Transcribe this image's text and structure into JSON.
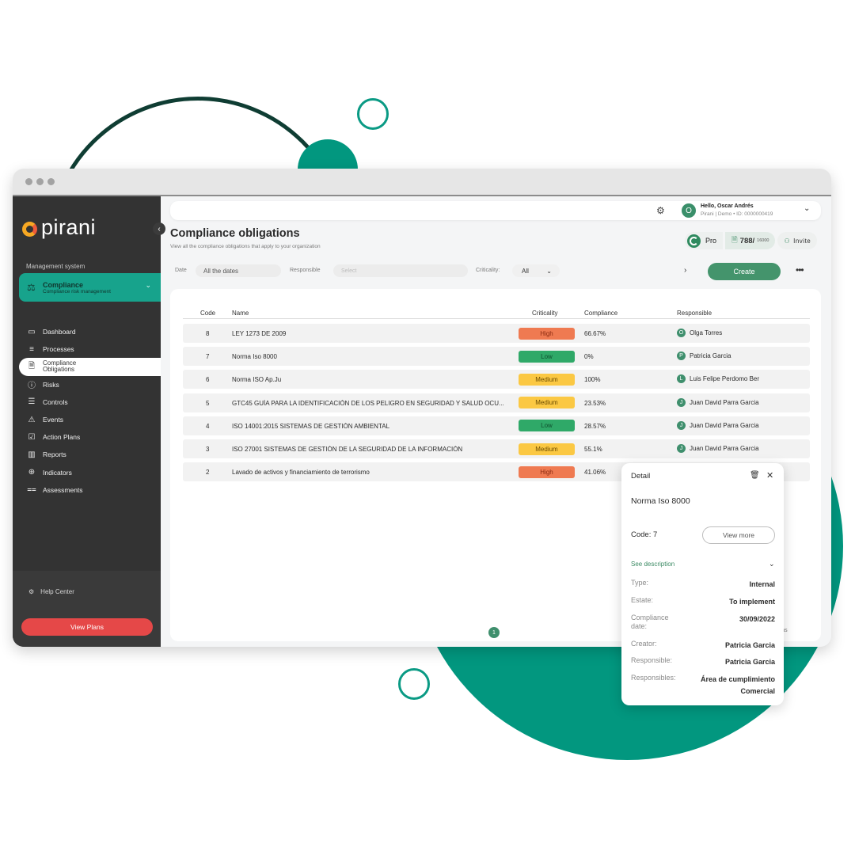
{
  "app": {
    "brand": "pirani",
    "colors": {
      "accent": "#17a38c",
      "primary_button": "#44946c",
      "danger_button": "#e54848",
      "high": "#ef7a51",
      "low": "#2fa968",
      "medium": "#fbc843",
      "sidebar": "#333333"
    }
  },
  "sidebar": {
    "section_label": "Management system",
    "module": {
      "title": "Compliance",
      "subtitle": "Compliance risk management",
      "icon": "compliance-icon"
    },
    "items": [
      {
        "label": "Dashboard",
        "icon": "monitor-icon",
        "active": false
      },
      {
        "label": "Processes",
        "icon": "list-icon",
        "active": false
      },
      {
        "label": "Compliance Obligations",
        "icon": "document-icon",
        "active": true
      },
      {
        "label": "Risks",
        "icon": "alert-circle-icon",
        "active": false
      },
      {
        "label": "Controls",
        "icon": "sliders-icon",
        "active": false
      },
      {
        "label": "Events",
        "icon": "warning-icon",
        "active": false
      },
      {
        "label": "Action Plans",
        "icon": "checkbox-icon",
        "active": false
      },
      {
        "label": "Reports",
        "icon": "bar-chart-icon",
        "active": false
      },
      {
        "label": "Indicators",
        "icon": "target-icon",
        "active": false
      },
      {
        "label": "Assessments",
        "icon": "assessment-icon",
        "active": false
      }
    ],
    "help_label": "Help Center",
    "view_plans_label": "View Plans"
  },
  "topbar": {
    "greeting": "Hello, Oscar Andrés",
    "user_initial": "O",
    "org_line": "Pirani | Demo • ID: 0000000419"
  },
  "header": {
    "title": "Compliance obligations",
    "subtitle": "View all the compliance obligations that apply to your organization",
    "plan_label": "Pro",
    "credits_used": "788/",
    "credits_total": "16000",
    "invite_label": "Invite"
  },
  "filters": {
    "date_label": "Date",
    "date_value": "All the dates",
    "responsible_label": "Responsible",
    "responsible_placeholder": "Select",
    "criticality_label": "Criticality:",
    "criticality_value": "All",
    "create_label": "Create",
    "more_label": "•••"
  },
  "table": {
    "columns": {
      "code": "Code",
      "name": "Name",
      "criticality": "Criticality",
      "compliance": "Compliance",
      "responsible": "Responsible"
    },
    "rows": [
      {
        "code": "8",
        "name": "LEY 1273 DE 2009",
        "criticality": "High",
        "compliance": "66.67%",
        "initial": "O",
        "responsible": "Olga Torres"
      },
      {
        "code": "7",
        "name": "Norma Iso 8000",
        "criticality": "Low",
        "compliance": "0%",
        "initial": "P",
        "responsible": "Patricia Garcia"
      },
      {
        "code": "6",
        "name": "Norma ISO Ap.Ju",
        "criticality": "Medium",
        "compliance": "100%",
        "initial": "L",
        "responsible": "Luis Felipe Perdomo Ber"
      },
      {
        "code": "5",
        "name": "GTC45 GUÍA PARA LA IDENTIFICACIÓN DE LOS PELIGRO EN SEGURIDAD Y SALUD OCU...",
        "criticality": "Medium",
        "compliance": "23.53%",
        "initial": "J",
        "responsible": "Juan David Parra Garcia"
      },
      {
        "code": "4",
        "name": "ISO 14001:2015 SISTEMAS DE GESTIÓN AMBIENTAL",
        "criticality": "Low",
        "compliance": "28.57%",
        "initial": "J",
        "responsible": "Juan David Parra Garcia"
      },
      {
        "code": "3",
        "name": "ISO 27001 SISTEMAS DE GESTIÓN DE LA SEGURIDAD DE LA INFORMACIÓN",
        "criticality": "Medium",
        "compliance": "55.1%",
        "initial": "J",
        "responsible": "Juan David Parra Garcia"
      },
      {
        "code": "2",
        "name": "Lavado de activos y financiamiento de terrorismo",
        "criticality": "High",
        "compliance": "41.06%",
        "initial": "",
        "responsible": ""
      }
    ],
    "page": "1",
    "footer_text": "ations"
  },
  "detail": {
    "title": "Detail",
    "name": "Norma Iso 8000",
    "code_label": "Code: 7",
    "view_more_label": "View more",
    "see_description_label": "See description",
    "fields": [
      {
        "key": "Type:",
        "value": "Internal"
      },
      {
        "key": "Estate:",
        "value": "To implement"
      },
      {
        "key": "Compliance date:",
        "value": "30/09/2022"
      },
      {
        "key": "Creator:",
        "value": "Patricia Garcia"
      },
      {
        "key": "Responsible:",
        "value": "Patricia Garcia"
      },
      {
        "key": "Responsibles:",
        "value": "Área de cumplimiento Comercial"
      }
    ]
  }
}
